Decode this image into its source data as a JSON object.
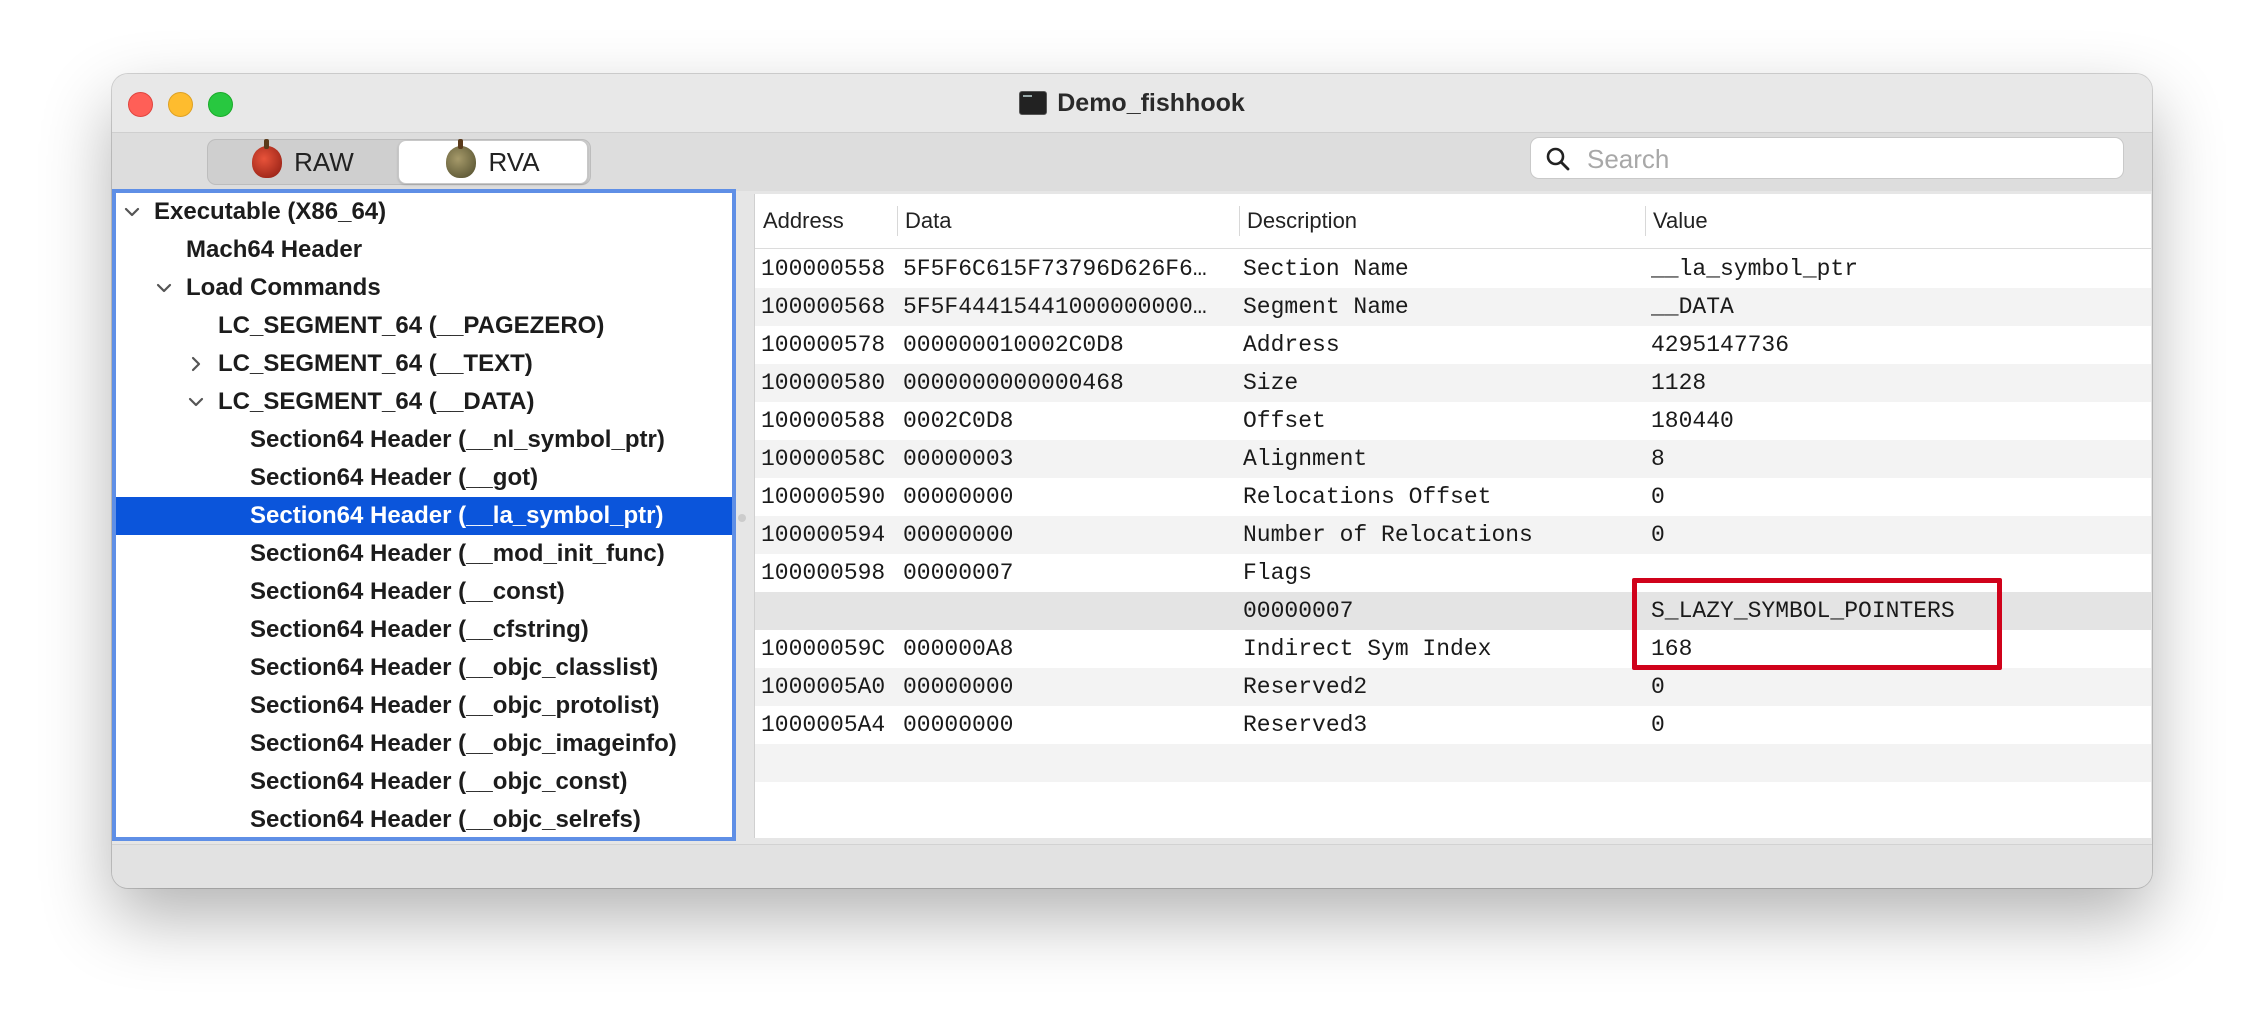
{
  "window": {
    "title": "Demo_fishhook"
  },
  "toolbar": {
    "raw_label": "RAW",
    "rva_label": "RVA",
    "search_placeholder": "Search"
  },
  "tree": [
    {
      "label": "Executable  (X86_64)",
      "chevron": "down",
      "selected": false
    },
    {
      "label": "Mach64 Header",
      "chevron": "none",
      "selected": false
    },
    {
      "label": "Load Commands",
      "chevron": "down",
      "selected": false
    },
    {
      "label": "LC_SEGMENT_64 (__PAGEZERO)",
      "chevron": "none",
      "selected": false
    },
    {
      "label": "LC_SEGMENT_64 (__TEXT)",
      "chevron": "right",
      "selected": false
    },
    {
      "label": "LC_SEGMENT_64 (__DATA)",
      "chevron": "down",
      "selected": false
    },
    {
      "label": "Section64 Header (__nl_symbol_ptr)",
      "chevron": "none",
      "selected": false
    },
    {
      "label": "Section64 Header (__got)",
      "chevron": "none",
      "selected": false
    },
    {
      "label": "Section64 Header (__la_symbol_ptr)",
      "chevron": "none",
      "selected": true
    },
    {
      "label": "Section64 Header (__mod_init_func)",
      "chevron": "none",
      "selected": false
    },
    {
      "label": "Section64 Header (__const)",
      "chevron": "none",
      "selected": false
    },
    {
      "label": "Section64 Header (__cfstring)",
      "chevron": "none",
      "selected": false
    },
    {
      "label": "Section64 Header (__objc_classlist)",
      "chevron": "none",
      "selected": false
    },
    {
      "label": "Section64 Header (__objc_protolist)",
      "chevron": "none",
      "selected": false
    },
    {
      "label": "Section64 Header (__objc_imageinfo)",
      "chevron": "none",
      "selected": false
    },
    {
      "label": "Section64 Header (__objc_const)",
      "chevron": "none",
      "selected": false
    },
    {
      "label": "Section64 Header (__objc_selrefs)",
      "chevron": "none",
      "selected": false
    }
  ],
  "table": {
    "columns": [
      "Address",
      "Data",
      "Description",
      "Value"
    ],
    "rows": [
      {
        "address": "100000558",
        "data": "5F5F6C615F73796D626F6…",
        "description": "Section Name",
        "value": "__la_symbol_ptr"
      },
      {
        "address": "100000568",
        "data": "5F5F44415441000000000…",
        "description": "Segment Name",
        "value": "__DATA"
      },
      {
        "address": "100000578",
        "data": "000000010002C0D8",
        "description": "Address",
        "value": "4295147736"
      },
      {
        "address": "100000580",
        "data": "0000000000000468",
        "description": "Size",
        "value": "1128"
      },
      {
        "address": "100000588",
        "data": "0002C0D8",
        "description": "Offset",
        "value": "180440"
      },
      {
        "address": "10000058C",
        "data": "00000003",
        "description": "Alignment",
        "value": "8"
      },
      {
        "address": "100000590",
        "data": "00000000",
        "description": "Relocations Offset",
        "value": "0"
      },
      {
        "address": "100000594",
        "data": "00000000",
        "description": "Number of Relocations",
        "value": "0"
      },
      {
        "address": "100000598",
        "data": "00000007",
        "description": "Flags",
        "value": ""
      },
      {
        "address": "",
        "data": "",
        "description": "00000007",
        "value": "S_LAZY_SYMBOL_POINTERS"
      },
      {
        "address": "10000059C",
        "data": "000000A8",
        "description": "Indirect Sym Index",
        "value": "168"
      },
      {
        "address": "1000005A0",
        "data": "00000000",
        "description": "Reserved2",
        "value": "0"
      },
      {
        "address": "1000005A4",
        "data": "00000000",
        "description": "Reserved3",
        "value": "0"
      }
    ]
  },
  "colors": {
    "selection": "#0b55db",
    "sidebar_focus_ring": "#5f8fe6",
    "annotation_box": "#d0021b"
  }
}
